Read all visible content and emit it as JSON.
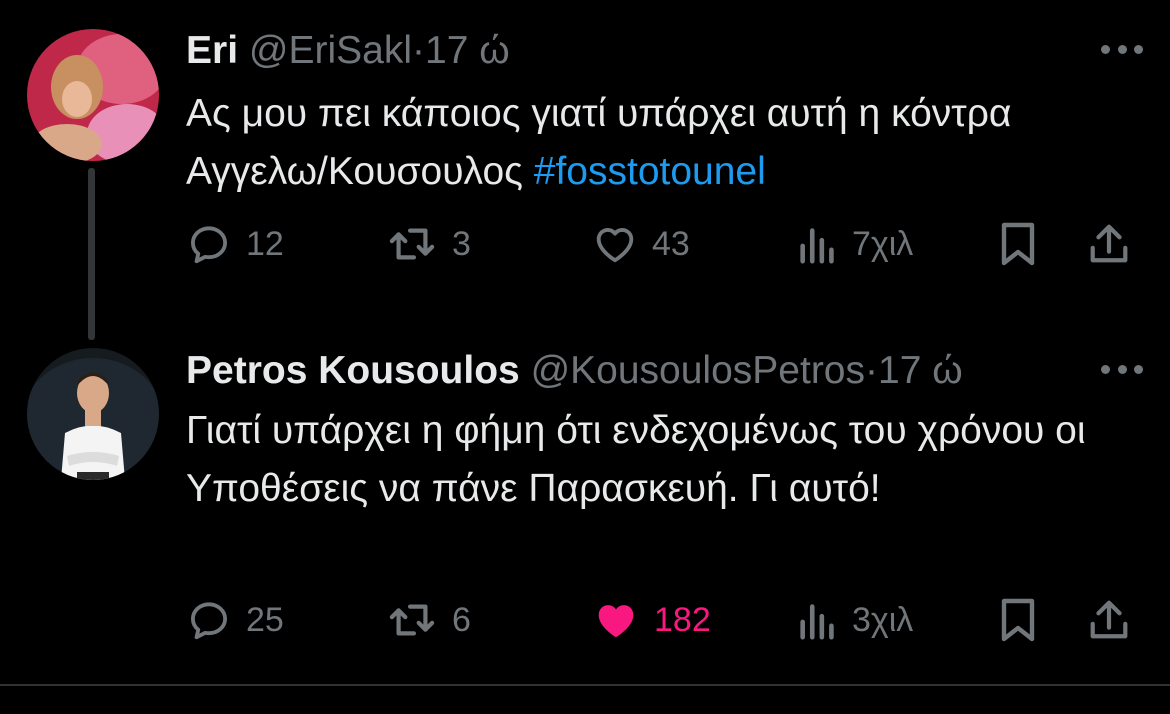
{
  "tweets": [
    {
      "name": "Eri",
      "handle": "@EriSakl",
      "separator": "·",
      "time": "17 ώ",
      "text_before": "Ας μου πει κάποιος γιατί υπάρχει αυτή η κόντρα Αγγελω/Κουσουλος ",
      "hashtag": "#fosstotounel",
      "replies": "12",
      "reposts": "3",
      "likes": "43",
      "views": "7χιλ",
      "liked": false
    },
    {
      "name": "Petros Kousoulos",
      "handle": "@KousoulosPetros",
      "separator": "·",
      "time": "17 ώ",
      "text_before": "Γιατί υπάρχει η φήμη ότι ενδεχομένως του χρόνου οι Υποθέσεις να πάνε Παρασκευή. Γι αυτό!",
      "replies": "25",
      "reposts": "6",
      "likes": "182",
      "views": "3χιλ",
      "liked": true
    }
  ],
  "colors": {
    "background": "#000000",
    "text": "#e7e9ea",
    "muted": "#71767b",
    "link": "#1d9bf0",
    "like": "#f91880"
  },
  "icons": [
    "reply-icon",
    "repost-icon",
    "like-icon",
    "views-icon",
    "bookmark-icon",
    "share-icon",
    "more-icon"
  ]
}
